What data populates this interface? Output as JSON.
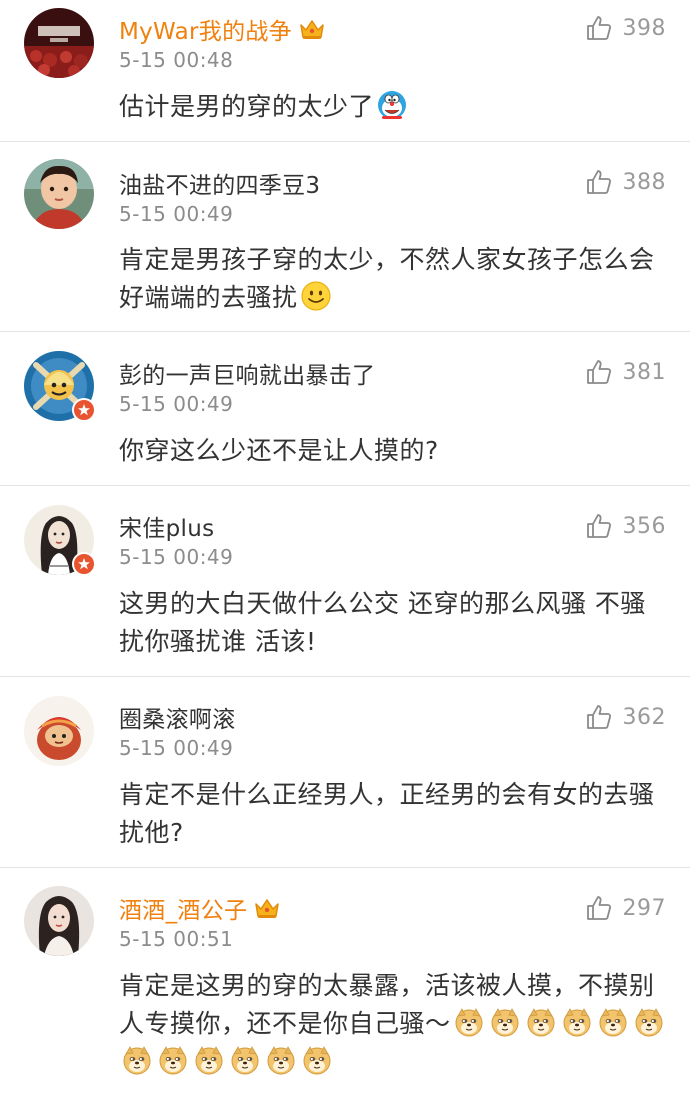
{
  "comments": [
    {
      "username": "MyWar我的战争",
      "vip": true,
      "time": "5-15 00:48",
      "likes": "398",
      "text": "估计是男的穿的太少了",
      "trailing_emojis": [
        "doraemon-emoji"
      ]
    },
    {
      "username": "油盐不进的四季豆3",
      "vip": false,
      "time": "5-15 00:49",
      "likes": "388",
      "text": "肯定是男孩子穿的太少，不然人家女孩子怎么会好端端的去骚扰",
      "trailing_emojis": [
        "smile-emoji"
      ]
    },
    {
      "username": "彭的一声巨响就出暴击了",
      "vip": false,
      "verified": true,
      "time": "5-15 00:49",
      "likes": "381",
      "text": "你穿这么少还不是让人摸的?"
    },
    {
      "username": "宋佳plus",
      "vip": false,
      "verified": true,
      "time": "5-15 00:49",
      "likes": "356",
      "text": "这男的大白天做什么公交 还穿的那么风骚 不骚扰你骚扰谁 活该!"
    },
    {
      "username": "圈桑滚啊滚",
      "vip": false,
      "time": "5-15 00:49",
      "likes": "362",
      "text": "肯定不是什么正经男人，正经男的会有女的去骚扰他?"
    },
    {
      "username": "酒酒_酒公子",
      "vip": true,
      "time": "5-15 00:51",
      "likes": "297",
      "text": "肯定是这男的穿的太暴露，活该被人摸，不摸别人专摸你，还不是你自己骚～",
      "trailing_emojis": [
        "doge-emoji",
        "doge-emoji",
        "doge-emoji",
        "doge-emoji",
        "doge-emoji",
        "doge-emoji",
        "doge-emoji",
        "doge-emoji",
        "doge-emoji",
        "doge-emoji",
        "doge-emoji",
        "doge-emoji"
      ]
    }
  ],
  "icons": {
    "like": "thumbs-up-icon",
    "vip_badge": "crown-icon",
    "verified_badge": "verified-star-icon"
  },
  "colors": {
    "vip_name": "#f0810f",
    "secondary_text": "#8c8c8c",
    "divider": "#e3e3e3",
    "verified_badge": "#e8542f"
  }
}
